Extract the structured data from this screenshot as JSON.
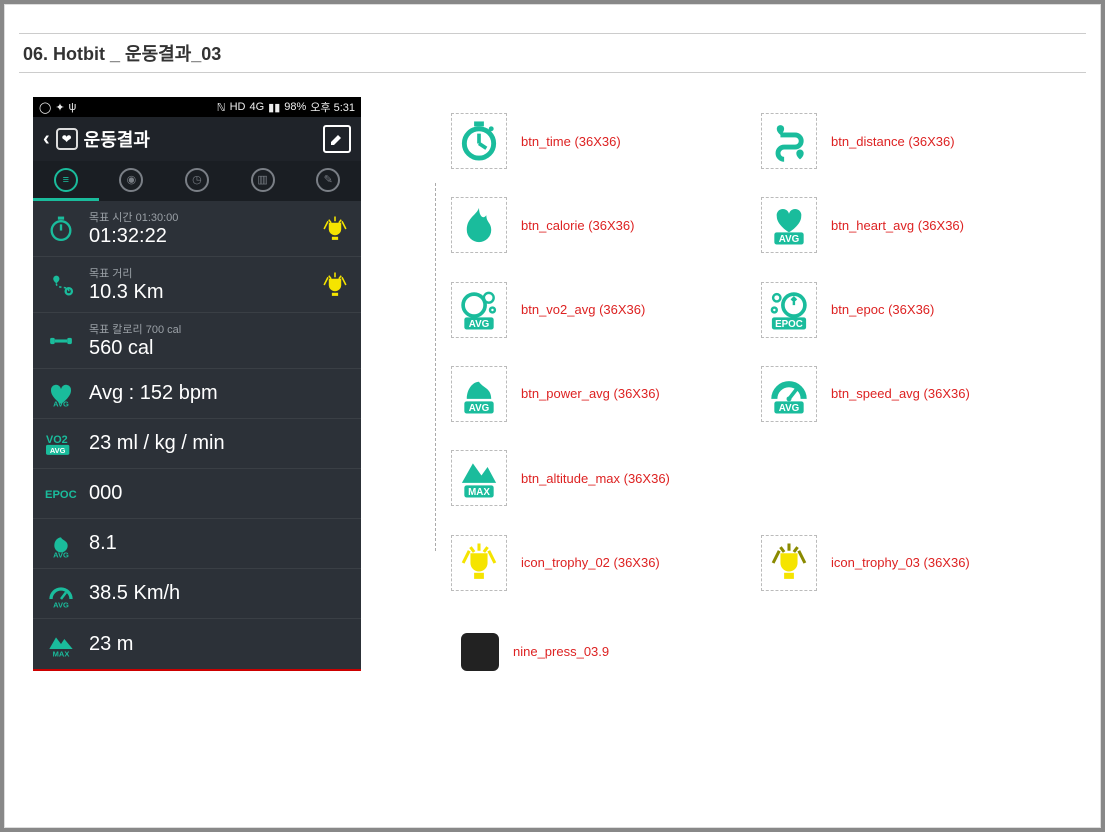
{
  "page_title": "06. Hotbit _ 운동결과_03",
  "phone": {
    "status": {
      "time": "오후 5:31",
      "battery": "98%",
      "net": "4G"
    },
    "header": {
      "title": "운동결과"
    },
    "rows": {
      "time": {
        "label": "목표 시간 01:30:00",
        "value": "01:32:22"
      },
      "dist": {
        "label": "목표 거리",
        "value": "10.3 Km"
      },
      "cal": {
        "label": "목표 칼로리 700 cal",
        "value": "560 cal"
      },
      "hr": {
        "value": "Avg : 152 bpm"
      },
      "vo2": {
        "value": "23 ml / kg / min"
      },
      "epoc": {
        "value": "000"
      },
      "power": {
        "value": "8.1"
      },
      "speed": {
        "value": "38.5 Km/h"
      },
      "alt": {
        "value": "23 m"
      }
    }
  },
  "assets": {
    "btn_time": "btn_time (36X36)",
    "btn_distance": "btn_distance (36X36)",
    "btn_calorie": "btn_calorie (36X36)",
    "btn_heart_avg": "btn_heart_avg (36X36)",
    "btn_vo2_avg": "btn_vo2_avg (36X36)",
    "btn_epoc": "btn_epoc (36X36)",
    "btn_power_avg": "btn_power_avg (36X36)",
    "btn_speed_avg": "btn_speed_avg (36X36)",
    "btn_altitude_max": "btn_altitude_max (36X36)",
    "icon_trophy_02": "icon_trophy_02 (36X36)",
    "icon_trophy_03": "icon_trophy_03 (36X36)",
    "nine_press": "nine_press_03.9"
  },
  "colors": {
    "teal": "#1abc9c",
    "red": "#d22",
    "yellow": "#f5e400"
  }
}
